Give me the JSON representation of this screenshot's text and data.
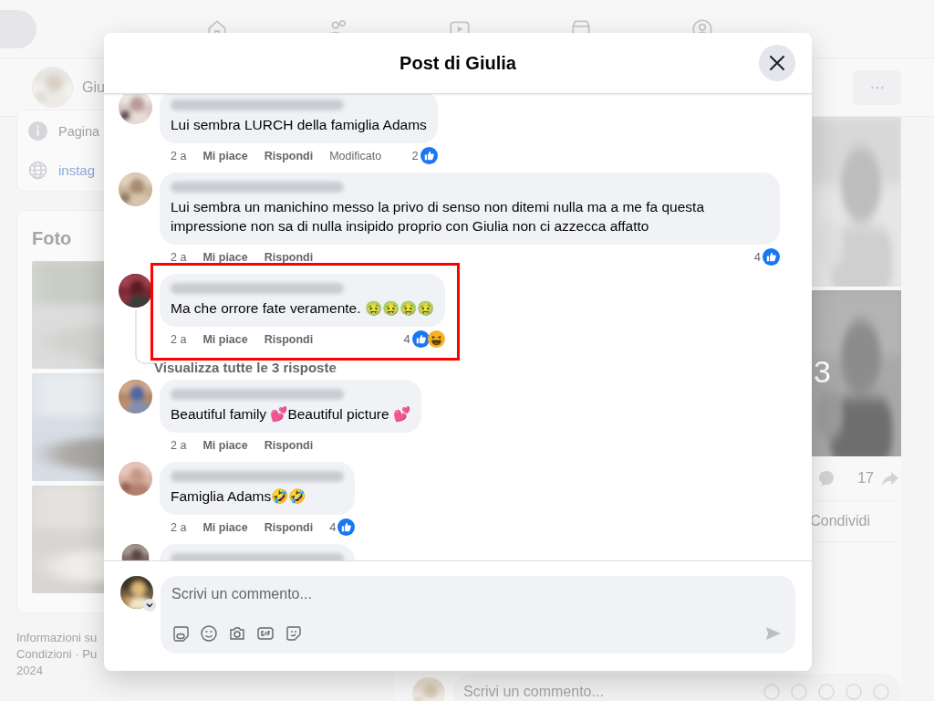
{
  "background": {
    "profile_name": "Giu",
    "intro": [
      {
        "kind": "info",
        "text": "Pagina"
      },
      {
        "kind": "link",
        "text": "instag"
      }
    ],
    "photos_title": "Foto",
    "photo_more": "3",
    "footer": [
      "Informazioni su",
      "Condizioni · Pu",
      "2024"
    ],
    "post_stats": {
      "shares": "17"
    },
    "post_actions": [
      "Condividi"
    ],
    "comment_placeholder": "Scrivi un commento..."
  },
  "dialog": {
    "title": "Post di Giulia",
    "comments": [
      {
        "kind": "full",
        "text": "Lui sembra LURCH della famiglia Adams",
        "time": "2 a",
        "actions": [
          "Mi piace",
          "Rispondi"
        ],
        "edited": "Modificato",
        "reaction_count": "2",
        "reactions": [
          {
            "kind": "like"
          }
        ],
        "highlighted": false
      },
      {
        "kind": "full",
        "text": "Lui sembra un manichino messo la privo di senso non ditemi nulla ma a me fa questa impressione non sa di nulla insipido proprio con Giulia non ci azzecca affatto",
        "time": "2 a",
        "actions": [
          "Mi piace",
          "Rispondi"
        ],
        "reaction_count": "4",
        "reactions": [
          {
            "kind": "like"
          }
        ],
        "highlighted": false
      },
      {
        "kind": "full",
        "text": "Ma che orrore fate veramente. 🤢🤢🤢🤢",
        "time": "2 a",
        "actions": [
          "Mi piace",
          "Rispondi"
        ],
        "reaction_count": "4",
        "reactions": [
          {
            "kind": "like"
          },
          {
            "kind": "haha"
          }
        ],
        "highlighted": true,
        "replies_link": "Visualizza tutte le 3 risposte"
      },
      {
        "kind": "full",
        "text": "Beautiful family 💕Beautiful picture 💕",
        "time": "2 a",
        "actions": [
          "Mi piace",
          "Rispondi"
        ],
        "highlighted": false
      },
      {
        "kind": "full",
        "text": "Famiglia Adams🤣🤣",
        "time": "2 a",
        "actions": [
          "Mi piace",
          "Rispondi"
        ],
        "reaction_count": "4",
        "reactions": [
          {
            "kind": "like"
          }
        ],
        "highlighted": false
      },
      {
        "kind": "cut",
        "highlighted": false
      }
    ],
    "composer": {
      "placeholder": "Scrivi un commento..."
    }
  }
}
